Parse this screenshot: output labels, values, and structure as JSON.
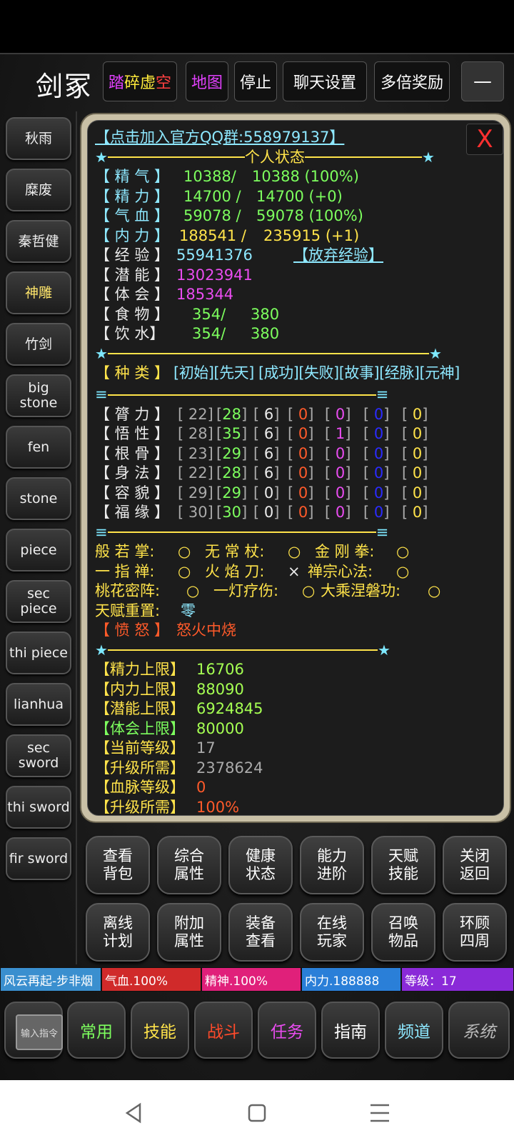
{
  "header": {
    "title": "剑冢",
    "buttons": {
      "shatter_void": [
        "踏",
        "碎",
        "虚",
        "空"
      ],
      "map": "地图",
      "stop": "停止",
      "chat_settings": "聊天设置",
      "multi_reward": "多倍奖励",
      "minimize": "—"
    }
  },
  "sidebar": {
    "items": [
      "秋雨",
      "糜废",
      "秦哲健",
      "神雕",
      "竹剑",
      "big stone",
      "fen",
      "stone",
      "piece",
      "sec piece",
      "thi piece",
      "lianhua",
      "sec sword",
      "thi sword",
      "fir sword"
    ]
  },
  "panel": {
    "close": "X",
    "qq_link": "【点击加入官方QQ群:558979137】",
    "section_personal": "个人状态",
    "vitals": [
      {
        "label": "【 精 气 】",
        "cur": "10388/",
        "max": "10388 (100%)"
      },
      {
        "label": "【 精 力 】",
        "cur": "14700 /",
        "max": "14700 (+0)"
      },
      {
        "label": "【 气 血 】",
        "cur": "59078 /",
        "max": "59078 (100%)"
      },
      {
        "label": "【 内 力 】",
        "cur": "188541 /",
        "max": "235915 (+1)"
      }
    ],
    "exp": {
      "label": "【 经 验 】",
      "value": "55941376",
      "action": "【放弃经验】"
    },
    "potential": {
      "label": "【 潜 能 】",
      "value": "13023941"
    },
    "insight": {
      "label": "【 体 会 】",
      "value": "185344"
    },
    "food": {
      "label": "【 食 物 】",
      "cur": "354/",
      "max": "380"
    },
    "water": {
      "label": "【 饮 水】",
      "cur": "354/",
      "max": "380"
    },
    "category": {
      "label": "【 种 类 】",
      "values": "[初始][先天] [成功][失败][故事][经脉][元神]"
    },
    "attributes": [
      {
        "label": "【 膂 力 】",
        "v": [
          "22",
          "28",
          "6",
          "0",
          "0",
          "0",
          "0"
        ],
        "v6": "0"
      },
      {
        "label": "【 悟 性 】",
        "v": [
          "28",
          "35",
          "6",
          "0",
          "1",
          "0",
          "0"
        ]
      },
      {
        "label": "【 根 骨 】",
        "v": [
          "23",
          "29",
          "6",
          "0",
          "0",
          "0",
          "0"
        ]
      },
      {
        "label": "【 身 法 】",
        "v": [
          "22",
          "28",
          "6",
          "0",
          "0",
          "0",
          "0"
        ]
      },
      {
        "label": "【 容 貌 】",
        "v": [
          "29",
          "29",
          "0",
          "0",
          "0",
          "0",
          "0"
        ]
      },
      {
        "label": "【 福 缘 】",
        "v": [
          "30",
          "30",
          "0",
          "0",
          "0",
          "0",
          "0"
        ]
      }
    ],
    "skills_row1": [
      {
        "name": "般 若 掌:",
        "mark": "○"
      },
      {
        "name": "无 常 杖:",
        "mark": "○"
      },
      {
        "name": "金 刚 拳:",
        "mark": "○"
      }
    ],
    "skills_row2": [
      {
        "name": "一 指 禅:",
        "mark": "○"
      },
      {
        "name": "火 焰 刀:",
        "mark": "×"
      },
      {
        "name": "禅宗心法:",
        "mark": "○"
      }
    ],
    "skills_row3": [
      {
        "name": "桃花密阵:",
        "mark": "○"
      },
      {
        "name": "一灯疗伤:",
        "mark": "○"
      },
      {
        "name": "大乘涅磐功:",
        "mark": "○"
      }
    ],
    "talent_reset": {
      "label": "天赋重置:",
      "value": "零"
    },
    "anger": {
      "label": "【 愤 怒 】",
      "value": "怒火中烧"
    },
    "limits": [
      {
        "label": "【精力上限】",
        "value": "16706",
        "color": "green"
      },
      {
        "label": "【内力上限】",
        "value": "88090",
        "color": "green"
      },
      {
        "label": "【潜能上限】",
        "value": "6924845",
        "color": "green"
      },
      {
        "label": "【体会上限】",
        "value": "80000",
        "color": "green"
      },
      {
        "label": "【当前等级】",
        "value": "17",
        "color": "grey"
      },
      {
        "label": "【升级所需】",
        "value": "2378624",
        "color": "grey"
      },
      {
        "label": "【血脉等级】",
        "value": "0",
        "color": "orange"
      },
      {
        "label": "【升级所需】",
        "value": "100%",
        "color": "orange"
      }
    ]
  },
  "functions": [
    [
      "查看",
      "背包"
    ],
    [
      "综合",
      "属性"
    ],
    [
      "健康",
      "状态"
    ],
    [
      "能力",
      "进阶"
    ],
    [
      "天赋",
      "技能"
    ],
    [
      "关闭",
      "返回"
    ],
    [
      "离线",
      "计划"
    ],
    [
      "附加",
      "属性"
    ],
    [
      "装备",
      "查看"
    ],
    [
      "在线",
      "玩家"
    ],
    [
      "召唤",
      "物品"
    ],
    [
      "环顾",
      "四周"
    ]
  ],
  "status_strip": {
    "player": "风云再起-步非烟",
    "hp": "气血.100%",
    "spirit": "精神.100%",
    "mana": "内力.188888",
    "level": "等级：17"
  },
  "tabs": {
    "command": "输入指令",
    "common": "常用",
    "skills": "技能",
    "battle": "战斗",
    "quest": "任务",
    "guide": "指南",
    "channel": "频道",
    "system": "系统"
  },
  "colors": {
    "yellow": "#ffe34a",
    "green": "#7dff5e",
    "cyan": "#8ee8ff",
    "magenta": "#e94cf0",
    "orange": "#ff5a2a"
  }
}
